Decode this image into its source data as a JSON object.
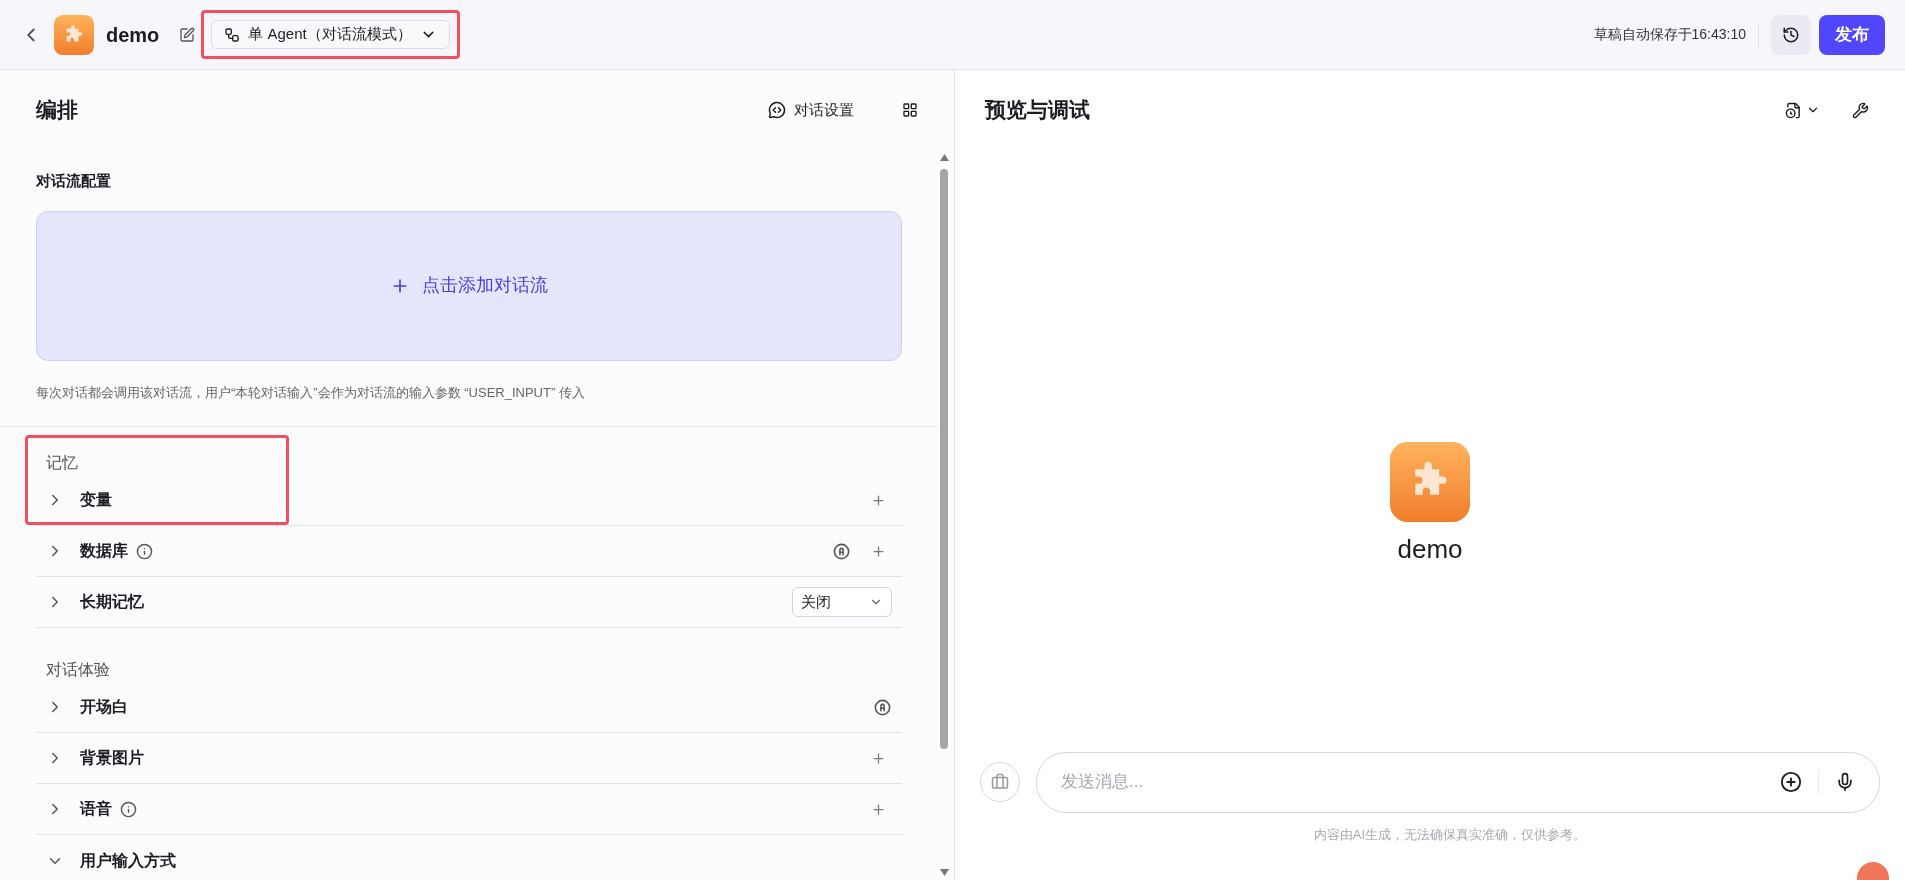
{
  "header": {
    "app_name": "demo",
    "mode_label": "单 Agent（对话流模式）",
    "autosave": "草稿自动保存于16:43:10",
    "publish": "发布"
  },
  "left": {
    "title": "编排",
    "settings": "对话设置",
    "flow_config": {
      "title": "对话流配置",
      "add_label": "点击添加对话流",
      "note": "每次对话都会调用该对话流，用户“本轮对话输入”会作为对话流的输入参数 “USER_INPUT” 传入"
    },
    "sections": [
      {
        "title": "记忆",
        "highlighted": true,
        "rows": [
          {
            "label": "变量",
            "expanded": false,
            "info": false,
            "auto": false,
            "add": true
          },
          {
            "label": "数据库",
            "expanded": false,
            "info": true,
            "auto": true,
            "add": true
          },
          {
            "label": "长期记忆",
            "expanded": false,
            "info": false,
            "auto": false,
            "add": false,
            "select": "关闭"
          }
        ]
      },
      {
        "title": "对话体验",
        "highlighted": false,
        "rows": [
          {
            "label": "开场白",
            "expanded": false,
            "info": false,
            "auto": true,
            "add": false
          },
          {
            "label": "背景图片",
            "expanded": false,
            "info": false,
            "auto": false,
            "add": true
          },
          {
            "label": "语音",
            "expanded": false,
            "info": true,
            "auto": false,
            "add": true
          },
          {
            "label": "用户输入方式",
            "expanded": true,
            "info": false,
            "auto": false,
            "add": false
          }
        ]
      }
    ]
  },
  "right": {
    "title": "预览与调试",
    "bot_name": "demo",
    "input_placeholder": "发送消息...",
    "disclaimer": "内容由AI生成，无法确保真实准确，仅供参考。"
  }
}
